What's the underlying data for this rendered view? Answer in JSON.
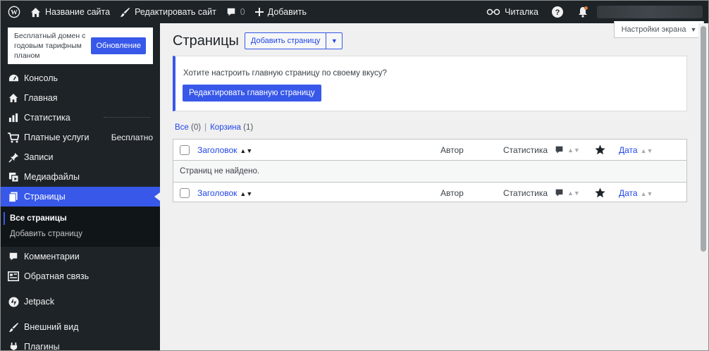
{
  "adminbar": {
    "site_name": "Название сайта",
    "edit_site": "Редактировать сайт",
    "comments_count": "0",
    "add_new": "Добавить",
    "reader": "Читалка"
  },
  "upsell": {
    "text": "Бесплатный домен с годовым тарифным планом",
    "button": "Обновление"
  },
  "sidebar": {
    "items": [
      {
        "label": "Консоль",
        "icon": "dashboard-icon"
      },
      {
        "label": "Главная",
        "icon": "home-icon"
      },
      {
        "label": "Статистика",
        "icon": "stats-icon"
      },
      {
        "label": "Платные услуги",
        "icon": "cart-icon",
        "extra": "Бесплатно"
      },
      {
        "label": "Записи",
        "icon": "pin-icon"
      },
      {
        "label": "Медиафайлы",
        "icon": "media-icon"
      },
      {
        "label": "Страницы",
        "icon": "pages-icon"
      },
      {
        "label": "Комментарии",
        "icon": "comments-icon"
      },
      {
        "label": "Обратная связь",
        "icon": "feedback-icon"
      },
      {
        "label": "Jetpack",
        "icon": "jetpack-icon"
      },
      {
        "label": "Внешний вид",
        "icon": "appearance-icon"
      },
      {
        "label": "Плагины",
        "icon": "plugins-icon"
      }
    ],
    "submenu": [
      "Все страницы",
      "Добавить страницу"
    ]
  },
  "main": {
    "screen_options": "Настройки экрана",
    "page_title": "Страницы",
    "add_page_button": "Добавить страницу",
    "notice_question": "Хотите настроить главную страницу по своему вкусу?",
    "notice_button": "Редактировать главную страницу",
    "filter_all": "Все",
    "filter_all_count": "(0)",
    "filter_trash": "Корзина",
    "filter_trash_count": "(1)",
    "table": {
      "col_title": "Заголовок",
      "col_author": "Автор",
      "col_stats": "Статистика",
      "col_date": "Дата",
      "empty_message": "Страниц не найдено."
    }
  },
  "colors": {
    "accent": "#3858e9",
    "sidebar_bg": "#1d2327",
    "link": "#2145e6",
    "background": "#f0f0f1"
  }
}
